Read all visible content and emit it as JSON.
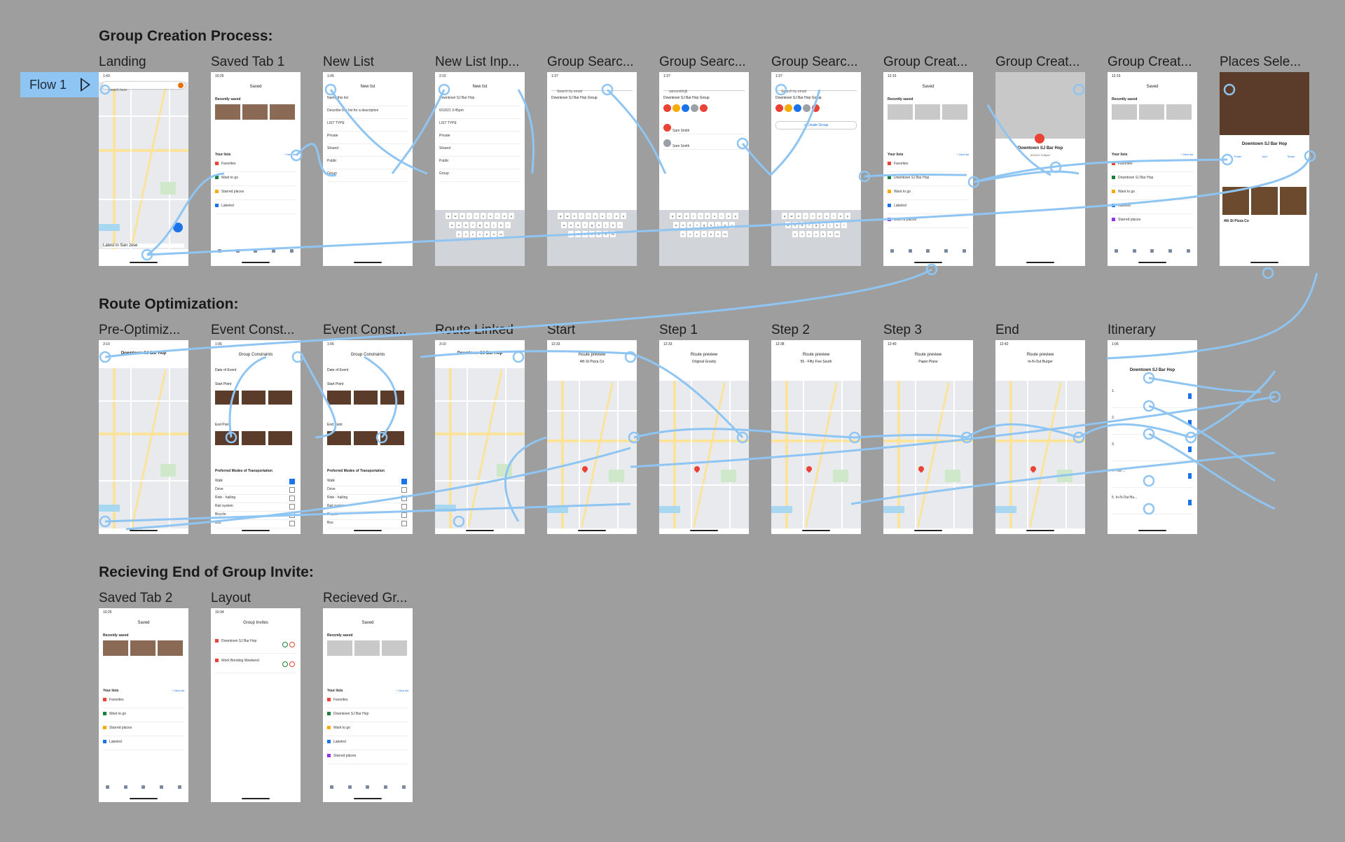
{
  "flow_badge": {
    "label": "Flow 1"
  },
  "sections": [
    {
      "title": "Group Creation Process:"
    },
    {
      "title": "Route Optimization:"
    },
    {
      "title": "Recieving End of Group Invite:"
    }
  ],
  "rows": [
    [
      {
        "label": "Landing",
        "screen": {
          "time": "1:43",
          "kind": "map",
          "title": "",
          "search": "Search here",
          "foot": "Latest in San Jose"
        }
      },
      {
        "label": "Saved Tab 1",
        "screen": {
          "time": "10:25",
          "kind": "saved",
          "title": "Saved",
          "recent": "Recently saved",
          "lists_title": "Your lists",
          "new_list": "+ New list",
          "items": [
            "Favorites",
            "Want to go",
            "Starred places",
            "Labeled"
          ]
        }
      },
      {
        "label": "New List",
        "screen": {
          "time": "1:06",
          "kind": "newlist",
          "title": "New list",
          "fields": [
            "Name this list",
            "Describe this list for a description",
            "LIST TYPE",
            "Private",
            "Shared",
            "Public",
            "Group"
          ]
        }
      },
      {
        "label": "New List Inp...",
        "screen": {
          "time": "2:15",
          "kind": "newlist-kb",
          "title": "New list",
          "fields": [
            "Downtown SJ Bar Hop",
            "6/10/21 3:45pm",
            "LIST TYPE",
            "Private",
            "Shared",
            "Public",
            "Group"
          ]
        }
      },
      {
        "label": "Group Searc...",
        "screen": {
          "time": "1:37",
          "kind": "search-kb",
          "title": "",
          "search": "Search by email",
          "line": "Downtown SJ Bar Hop Group"
        }
      },
      {
        "label": "Group Searc...",
        "screen": {
          "time": "1:37",
          "kind": "search-suggest",
          "title": "",
          "search": "samsmith@",
          "line": "Downtown SJ Bar Hop Group",
          "suggest": [
            "Sam Smith",
            "Sam Smith"
          ]
        }
      },
      {
        "label": "Group Searc...",
        "screen": {
          "time": "1:37",
          "kind": "search-create",
          "title": "",
          "search": "Search by email",
          "line": "Downtown SJ Bar Hop Group",
          "button": "+ Create Group"
        }
      },
      {
        "label": "Group Creat...",
        "screen": {
          "time": "12:15",
          "kind": "saved-grey",
          "title": "Saved",
          "recent": "Recently saved",
          "lists_title": "Your lists",
          "new_list": "+ New list",
          "items": [
            "Favorites",
            "Downtown SJ Bar Hop",
            "Want to go",
            "Labeled",
            "Starred places"
          ]
        }
      },
      {
        "label": "Group Creat...",
        "screen": {
          "time": "11:28",
          "kind": "group-map",
          "title": "Downtown SJ Bar Hop",
          "sub": "6/10/21 3:45pm"
        }
      },
      {
        "label": "Group Creat...",
        "screen": {
          "time": "12:15",
          "kind": "saved-grey",
          "title": "Saved",
          "recent": "Recently saved",
          "lists_title": "Your lists",
          "new_list": "+ New list",
          "items": [
            "Favorites",
            "Downtown SJ Bar Hop",
            "Want to go",
            "Labeled",
            "Starred places"
          ]
        }
      },
      {
        "label": "Places Sele...",
        "screen": {
          "time": "12:23",
          "kind": "places",
          "title": "Downtown SJ Bar Hop",
          "sub": "4th St Pizza Co",
          "actions": [
            "Public",
            "Add",
            "Share"
          ]
        }
      }
    ],
    [
      {
        "label": "Pre-Optimiz...",
        "screen": {
          "time": "3:10",
          "kind": "map-header",
          "title": "Downtown SJ Bar Hop"
        }
      },
      {
        "label": "Event Const...",
        "screen": {
          "time": "1:06",
          "kind": "constraints",
          "title": "Group Constraints",
          "date": "Date of Event",
          "start": "Start Point",
          "end": "End Point",
          "modes_title": "Preferred Modes of Transportation",
          "modes": [
            "Walk",
            "Drive",
            "Ride - hailing",
            "Rail system",
            "Bicycle",
            "Bus"
          ]
        }
      },
      {
        "label": "Event Const...",
        "screen": {
          "time": "1:06",
          "kind": "constraints",
          "title": "Group Constraints",
          "date": "Date of Event",
          "start": "Start Point",
          "end": "End Point",
          "modes_title": "Preferred Modes of Transportation",
          "modes": [
            "Walk",
            "Drive",
            "Ride - hailing",
            "Rail system",
            "Bicycle",
            "Bus"
          ]
        }
      },
      {
        "label": "Route Linked",
        "screen": {
          "time": "3:10",
          "kind": "map-header",
          "title": "Downtown SJ Bar Hop"
        }
      },
      {
        "label": "Start",
        "screen": {
          "time": "12:33",
          "kind": "route",
          "title": "Route preview",
          "stop": "4th St Pizza Co"
        }
      },
      {
        "label": "Step 1",
        "screen": {
          "time": "12:33",
          "kind": "route",
          "title": "Route preview",
          "stop": "Original Gravity"
        }
      },
      {
        "label": "Step 2",
        "screen": {
          "time": "12:38",
          "kind": "route",
          "title": "Route preview",
          "stop": "55 - Fifty Five South"
        }
      },
      {
        "label": "Step 3",
        "screen": {
          "time": "12:40",
          "kind": "route",
          "title": "Route preview",
          "stop": "Paper Plane"
        }
      },
      {
        "label": "End",
        "screen": {
          "time": "12:42",
          "kind": "route",
          "title": "Route preview",
          "stop": "In-N-Out Burger"
        }
      },
      {
        "label": "Itinerary",
        "screen": {
          "time": "1:06",
          "kind": "itinerary",
          "title": "Downtown SJ Bar Hop",
          "stops": [
            "1.",
            "2.",
            "3.",
            "4. The ...",
            "5. In-N-Out Bu..."
          ]
        }
      }
    ],
    [
      {
        "label": "Saved Tab 2",
        "screen": {
          "time": "10:25",
          "kind": "saved",
          "title": "Saved",
          "recent": "Recently saved",
          "lists_title": "Your lists",
          "new_list": "+ New list",
          "items": [
            "Favorites",
            "Want to go",
            "Starred places",
            "Labeled"
          ]
        }
      },
      {
        "label": "Layout",
        "screen": {
          "time": "10:34",
          "kind": "invites",
          "title": "Group Invites",
          "invites": [
            "Downtown SJ Bar Hop",
            "Work Bonding Weekend"
          ]
        }
      },
      {
        "label": "Recieved Gr...",
        "screen": {
          "time": "",
          "kind": "saved-grey",
          "title": "Saved",
          "recent": "Recently saved",
          "lists_title": "Your lists",
          "new_list": "+ New list",
          "items": [
            "Favorites",
            "Downtown SJ Bar Hop",
            "Want to go",
            "Labeled",
            "Starred places"
          ]
        }
      }
    ]
  ],
  "colors": {
    "canvas": "#9e9e9e",
    "connector": "#8fc5f2",
    "badge": "#8fc5f2",
    "accent": "#1a73e8",
    "pin": "#ea4335"
  }
}
